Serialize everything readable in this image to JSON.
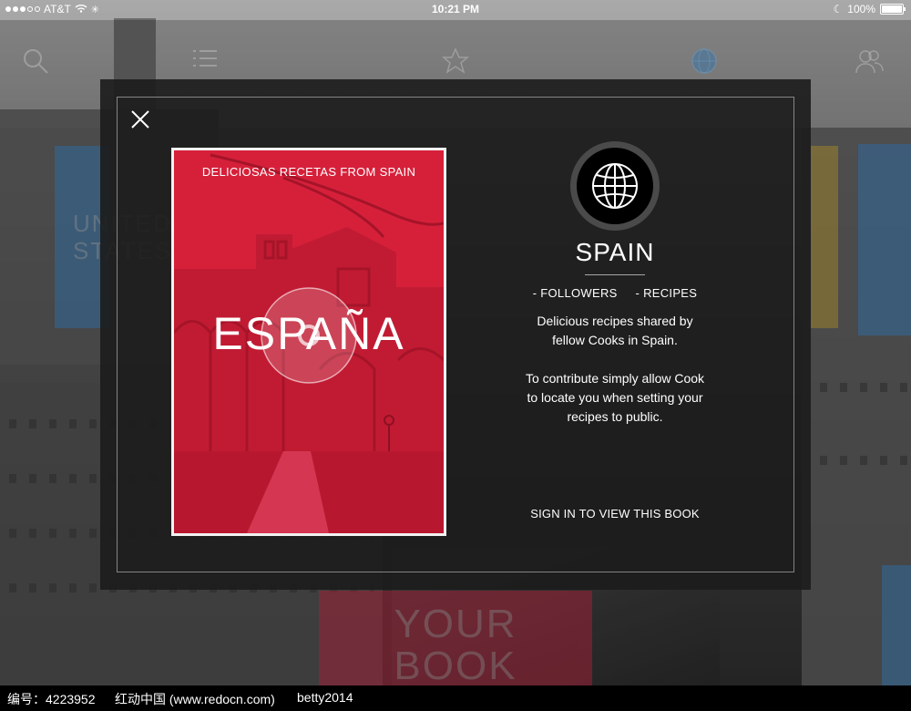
{
  "status_bar": {
    "carrier": "AT&T",
    "time": "10:21 PM",
    "battery": "100%"
  },
  "background": {
    "tiles": [
      {
        "text_line1": "UNITED",
        "text_line2": "STATES",
        "color": "#3f87c8"
      },
      {
        "text_line1": "YOUR",
        "text_line2": "BOOK",
        "color": "#c82a45"
      }
    ]
  },
  "modal": {
    "cover": {
      "header": "DELICIOSAS RECETAS FROM SPAIN",
      "title": "ESPAÑA",
      "color": "#d6203a"
    },
    "country": "SPAIN",
    "stats": {
      "followers": "- FOLLOWERS",
      "recipes": "- RECIPES"
    },
    "description_line1": "Delicious recipes shared by",
    "description_line2": "fellow Cooks in Spain.",
    "contribute_line1": "To contribute simply allow Cook",
    "contribute_line2": "to locate you when setting your",
    "contribute_line3": "recipes to public.",
    "signin_label": "SIGN IN TO VIEW THIS BOOK"
  },
  "footer": {
    "id_label": "编号：4223952",
    "site": "红动中国 (www.redocn.com)",
    "user": "betty2014"
  },
  "icons": [
    "search-icon",
    "list-icon",
    "star-icon",
    "globe-icon",
    "people-icon",
    "close-icon"
  ]
}
